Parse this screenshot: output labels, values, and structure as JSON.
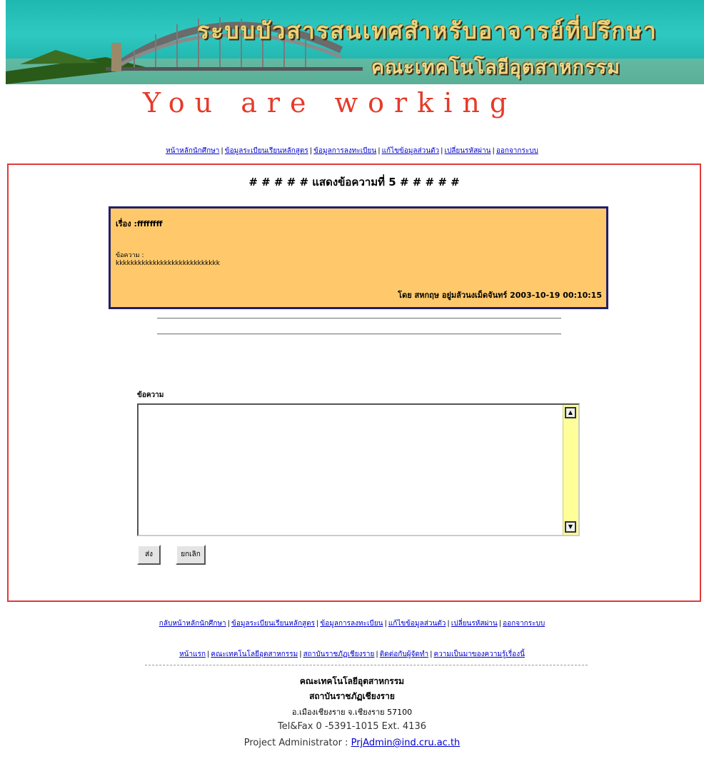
{
  "banner": {
    "title": "ระบบบัวสารสนเทศสำหรับอาจารย์ที่ปรึกษา",
    "subtitle": "คณะเทคโนโลยีอุตสาหกรรม",
    "logo_icon": "bridge-icon"
  },
  "working_text": "You are working",
  "nav_top": [
    "หน้าหลักนักศึกษา",
    "ข้อมูลระเบียนเรียนหลักสูตร",
    "ข้อมูลการลงทะเบียน",
    "แก้ไขข้อมูลส่วนตัว",
    "เปลี่ยนรหัสผ่าน",
    "ออกจากระบบ"
  ],
  "heading": "# # # # # แสดงข้อความที่ 5 # # # # #",
  "message": {
    "subject": "เรื่อง :ffffffff",
    "body_label": "ข้อความ :",
    "body": "kkkkkkkkkkkkkkkkkkkkkkkkkkkk",
    "footer": "โดย สหกฤษ อยู่มลัวนงเม็ดจันทร์ 2003-10-19 00:10:15"
  },
  "reply": {
    "label": "ข้อความ",
    "value": "",
    "send_label": "ส่ง",
    "cancel_label": "ยกเลิก"
  },
  "nav_bottom": [
    "กลับหน้าหลักนักศึกษา",
    "ข้อมูลระเบียนเรียนหลักสูตร",
    "ข้อมูลการลงทะเบียน",
    "แก้ไขข้อมูลส่วนตัว",
    "เปลี่ยนรหัสผ่าน",
    "ออกจากระบบ"
  ],
  "nav_bottom2": [
    "หน้าแรก",
    "คณะเทคโนโลยีอุตสาหกรรม",
    "สถาบันราชภัฏเชียงราย",
    "ติดต่อกับผู้จัดทำ",
    "ความเป็นมาของความรู้เรื่องนี้"
  ],
  "footer": {
    "line1": "คณะเทคโนโลยีอุตสาหกรรม",
    "line2": "สถาบันราชภัฏเชียงราย",
    "line3": "อ.เมืองเชียงราย จ.เชียงราย 57100",
    "line4": "Tel&Fax 0 -5391-1015 Ext. 4136",
    "admin_label": "Project Administrator : ",
    "admin_email": "PrjAdmin@ind.cru.ac.th"
  },
  "colors": {
    "panel_border": "#e03a3a",
    "message_bg": "#ffc96b",
    "message_border": "#20206a",
    "link": "#0000cc",
    "banner": "#1fb8b0"
  }
}
